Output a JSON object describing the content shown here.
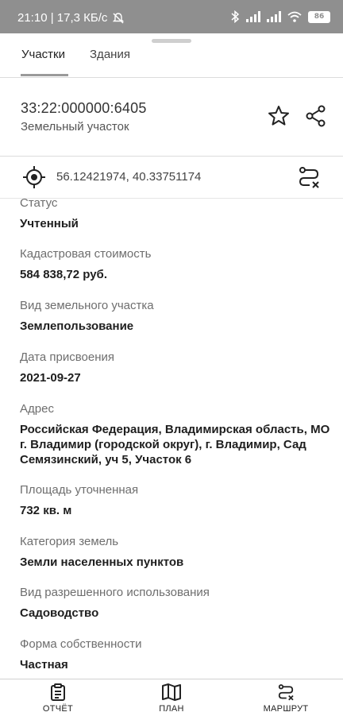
{
  "status_bar": {
    "time_speed": "21:10 | 17,3 КБ/с",
    "battery": "86",
    "icons": [
      "mute-icon",
      "bluetooth-icon",
      "signal-icon",
      "signal-icon",
      "wifi-icon",
      "battery-icon"
    ]
  },
  "tabs": [
    {
      "label": "Участки",
      "active": true
    },
    {
      "label": "Здания",
      "active": false
    }
  ],
  "header": {
    "cadastral_number": "33:22:000000:6405",
    "subtitle": "Земельный участок"
  },
  "coordinates": {
    "text": "56.12421974, 40.33751174"
  },
  "fields": [
    {
      "label": "Статус",
      "value": "Учтенный"
    },
    {
      "label": "Кадастровая стоимость",
      "value": "584 838,72 руб."
    },
    {
      "label": "Вид земельного участка",
      "value": "Землепользование"
    },
    {
      "label": "Дата присвоения",
      "value": "2021-09-27"
    },
    {
      "label": "Адрес",
      "value": "Российская Федерация, Владимирская область, МО г. Владимир (городской округ), г. Владимир, Сад Семязинский, уч 5, Участок 6"
    },
    {
      "label": "Площадь уточненная",
      "value": "732 кв. м"
    },
    {
      "label": "Категория земель",
      "value": "Земли населенных пунктов"
    },
    {
      "label": "Вид разрешенного использования",
      "value": "Садоводство"
    },
    {
      "label": "Форма собственности",
      "value": "Частная"
    }
  ],
  "bottom_nav": [
    {
      "label": "ОТЧЁТ",
      "icon": "report-icon"
    },
    {
      "label": "ПЛАН",
      "icon": "map-icon"
    },
    {
      "label": "МАРШРУТ",
      "icon": "route-icon"
    }
  ]
}
